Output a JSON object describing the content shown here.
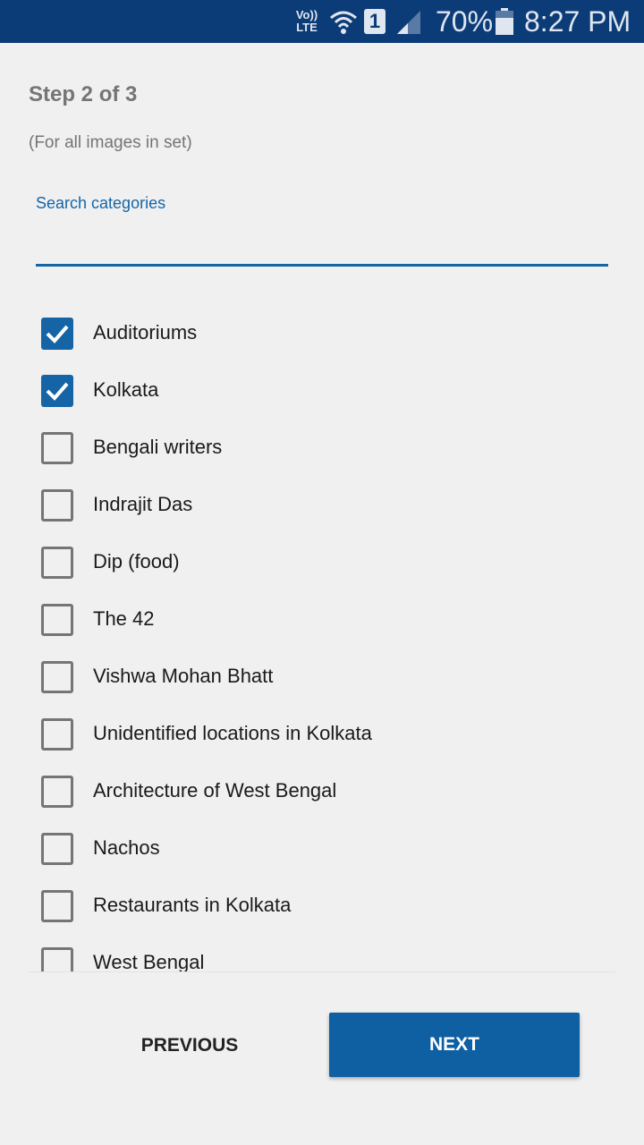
{
  "status_bar": {
    "volte_label": "Vo)) LTE",
    "sim_label": "1",
    "battery_percent": "70%",
    "time": "8:27 PM",
    "icons": [
      "volte-icon",
      "wifi-icon",
      "sim-icon",
      "signal-icon",
      "battery-icon"
    ]
  },
  "header": {
    "step": "Step 2 of 3",
    "subtitle": "(For all images in set)"
  },
  "search": {
    "label": "Search categories",
    "value": ""
  },
  "categories": [
    {
      "label": "Auditoriums",
      "checked": true
    },
    {
      "label": "Kolkata",
      "checked": true
    },
    {
      "label": "Bengali writers",
      "checked": false
    },
    {
      "label": "Indrajit Das",
      "checked": false
    },
    {
      "label": "Dip (food)",
      "checked": false
    },
    {
      "label": "The 42",
      "checked": false
    },
    {
      "label": "Vishwa Mohan Bhatt",
      "checked": false
    },
    {
      "label": "Unidentified locations in Kolkata",
      "checked": false
    },
    {
      "label": "Architecture of West Bengal",
      "checked": false
    },
    {
      "label": "Nachos",
      "checked": false
    },
    {
      "label": "Restaurants in Kolkata",
      "checked": false
    },
    {
      "label": "West Bengal",
      "checked": false
    }
  ],
  "actions": {
    "previous": "PREVIOUS",
    "next": "NEXT"
  },
  "colors": {
    "status_bar": "#0c3c78",
    "accent": "#1565a6",
    "primary_button": "#0f5fa3",
    "background": "#f0f0f0"
  }
}
